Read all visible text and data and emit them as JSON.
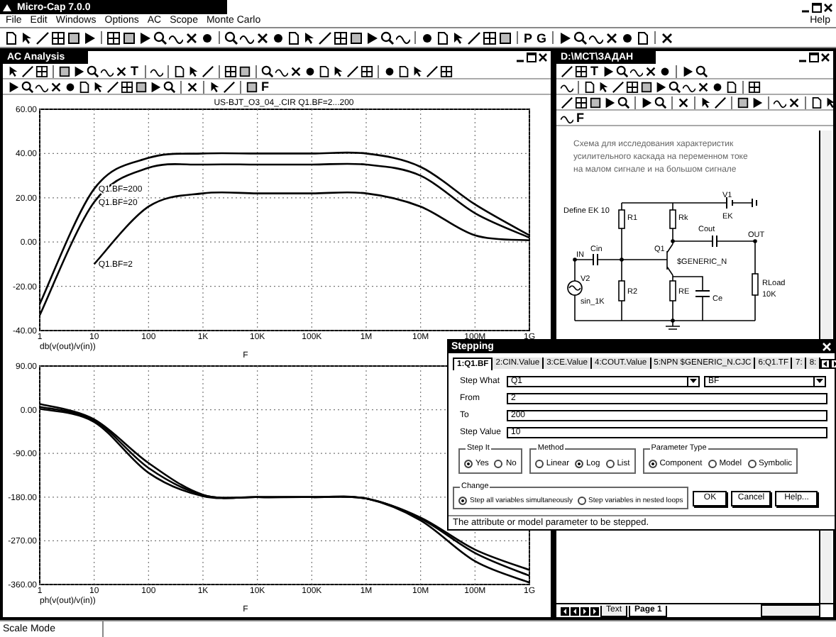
{
  "window": {
    "title": "Micro-Cap 7.0.0"
  },
  "menu": [
    "File",
    "Edit",
    "Windows",
    "Options",
    "AC",
    "Scope",
    "Monte Carlo"
  ],
  "help_menu": "Help",
  "toolbar": [
    [
      {
        "kind": "icon"
      },
      {
        "kind": "icon"
      },
      {
        "kind": "icon"
      },
      {
        "kind": "icon"
      },
      {
        "kind": "icon"
      },
      {
        "kind": "icon"
      }
    ],
    [
      {
        "kind": "icon"
      },
      {
        "kind": "icon"
      },
      {
        "kind": "icon"
      },
      {
        "kind": "icon"
      },
      {
        "kind": "icon"
      },
      {
        "kind": "icon"
      },
      {
        "kind": "icon"
      }
    ],
    [
      {
        "kind": "icon"
      },
      {
        "kind": "icon"
      },
      {
        "kind": "icon"
      },
      {
        "kind": "icon"
      },
      {
        "kind": "icon"
      },
      {
        "kind": "icon"
      },
      {
        "kind": "icon"
      },
      {
        "kind": "icon"
      },
      {
        "kind": "icon"
      },
      {
        "kind": "icon"
      },
      {
        "kind": "icon"
      },
      {
        "kind": "icon"
      }
    ],
    [
      {
        "kind": "icon"
      },
      {
        "kind": "icon"
      },
      {
        "kind": "icon"
      },
      {
        "kind": "icon"
      },
      {
        "kind": "icon"
      },
      {
        "kind": "icon"
      }
    ],
    [
      {
        "kind": "text",
        "label": "P"
      },
      {
        "kind": "text",
        "label": "G"
      }
    ],
    [
      {
        "kind": "icon"
      },
      {
        "kind": "icon"
      },
      {
        "kind": "icon"
      },
      {
        "kind": "icon"
      },
      {
        "kind": "icon"
      },
      {
        "kind": "icon"
      }
    ],
    [
      {
        "kind": "icon"
      }
    ]
  ],
  "ac_window": {
    "title": "AC Analysis",
    "toolbar_rows": [
      [
        [
          {
            "kind": "icon"
          },
          {
            "kind": "icon"
          },
          {
            "kind": "icon"
          }
        ],
        [
          {
            "kind": "icon"
          },
          {
            "kind": "icon"
          },
          {
            "kind": "icon"
          },
          {
            "kind": "icon"
          },
          {
            "kind": "icon"
          },
          {
            "kind": "text",
            "label": "T"
          }
        ],
        [
          {
            "kind": "icon"
          }
        ],
        [
          {
            "kind": "icon"
          },
          {
            "kind": "icon"
          },
          {
            "kind": "icon"
          }
        ],
        [
          {
            "kind": "icon"
          },
          {
            "kind": "icon"
          }
        ],
        [
          {
            "kind": "icon"
          },
          {
            "kind": "icon"
          },
          {
            "kind": "icon"
          },
          {
            "kind": "icon"
          },
          {
            "kind": "icon"
          },
          {
            "kind": "icon"
          },
          {
            "kind": "icon"
          },
          {
            "kind": "icon"
          }
        ],
        [
          {
            "kind": "icon"
          },
          {
            "kind": "icon"
          },
          {
            "kind": "icon"
          },
          {
            "kind": "icon"
          },
          {
            "kind": "icon"
          }
        ]
      ],
      [
        [
          {
            "kind": "icon"
          },
          {
            "kind": "icon"
          },
          {
            "kind": "icon"
          },
          {
            "kind": "icon"
          },
          {
            "kind": "icon"
          },
          {
            "kind": "icon"
          },
          {
            "kind": "icon"
          },
          {
            "kind": "icon"
          },
          {
            "kind": "icon"
          },
          {
            "kind": "icon"
          },
          {
            "kind": "icon"
          },
          {
            "kind": "icon"
          }
        ],
        [
          {
            "kind": "icon"
          }
        ],
        [
          {
            "kind": "icon"
          },
          {
            "kind": "icon"
          }
        ],
        [
          {
            "kind": "icon"
          },
          {
            "kind": "text",
            "label": "F"
          }
        ]
      ]
    ],
    "upper_plot": {
      "expression": "db(v(out)/v(in))",
      "chart_data": {
        "type": "line",
        "grid": true,
        "title": "US-BJT_O3_04_.CIR Q1.BF=2...200",
        "xlabel": "F",
        "categories": [
          "1",
          "10",
          "100",
          "1K",
          "10K",
          "100K",
          "1M",
          "10M",
          "100M",
          "1G"
        ],
        "series": [
          {
            "name": "Q1.BF=200",
            "color": "#000000",
            "values": [
              -28,
              24,
              38,
              40,
              40,
              40,
              40,
              34,
              17,
              3
            ]
          },
          {
            "name": "Q1.BF=20",
            "color": "#000000",
            "values": [
              -33,
              18,
              33.5,
              35,
              35,
              35,
              35,
              30,
              13,
              2
            ]
          },
          {
            "name": "Q1.BF=2",
            "color": "#000000",
            "values": [
              null,
              -10,
              16,
              22,
              22,
              22,
              22,
              16,
              3,
              0.8
            ]
          }
        ],
        "ylim": [
          -40,
          60
        ],
        "yticks": [
          {
            "value": 60,
            "label": "60.00"
          },
          {
            "value": 40,
            "label": "40.00"
          },
          {
            "value": 20,
            "label": "20.00"
          },
          {
            "value": 0,
            "label": "0.00"
          },
          {
            "value": -20,
            "label": "-20.00"
          },
          {
            "value": -40,
            "label": "-40.00"
          }
        ]
      }
    },
    "lower_plot": {
      "expression": "ph(v(out)/v(in))",
      "chart_data": {
        "type": "line",
        "grid": true,
        "xlabel": "F",
        "categories": [
          "1",
          "10",
          "100",
          "1K",
          "10K",
          "100K",
          "1M",
          "10M",
          "100M",
          "1G"
        ],
        "series": [
          {
            "color": "#000000",
            "values": [
              12,
              -20,
              -110,
              -175,
              -180,
              -180,
              -183,
              -222,
              -288,
              -330
            ]
          },
          {
            "color": "#000000",
            "values": [
              6,
              -22,
              -120,
              -176,
              -180,
              -180,
              -183,
              -224,
              -295,
              -342
            ]
          },
          {
            "color": "#000000",
            "values": [
              2,
              -25,
              -130,
              -178,
              -180,
              -180,
              -183,
              -228,
              -312,
              -356
            ]
          }
        ],
        "ylim": [
          -360,
          90
        ],
        "yticks": [
          {
            "value": 90,
            "label": "90.00"
          },
          {
            "value": 0,
            "label": "0.00"
          },
          {
            "value": -90,
            "label": "-90.00"
          },
          {
            "value": -180,
            "label": "-180.00"
          },
          {
            "value": -270,
            "label": "-270.00"
          },
          {
            "value": -360,
            "label": "-360.00"
          }
        ]
      }
    }
  },
  "schematic_window": {
    "title": "D:\\МСТ\\ЗАДАН",
    "toolbar_rows": [
      [
        [
          {
            "kind": "icon"
          },
          {
            "kind": "icon"
          },
          {
            "kind": "text",
            "label": "T"
          },
          {
            "kind": "icon"
          },
          {
            "kind": "icon"
          },
          {
            "kind": "icon"
          },
          {
            "kind": "icon"
          },
          {
            "kind": "icon"
          }
        ],
        [
          {
            "kind": "icon"
          },
          {
            "kind": "icon"
          }
        ]
      ],
      [
        [
          {
            "kind": "icon"
          }
        ],
        [
          {
            "kind": "icon"
          },
          {
            "kind": "icon"
          },
          {
            "kind": "icon"
          },
          {
            "kind": "icon"
          },
          {
            "kind": "icon"
          },
          {
            "kind": "icon"
          },
          {
            "kind": "icon"
          },
          {
            "kind": "icon"
          },
          {
            "kind": "icon"
          },
          {
            "kind": "icon"
          },
          {
            "kind": "icon"
          }
        ],
        [
          {
            "kind": "icon"
          }
        ]
      ],
      [
        [
          {
            "kind": "icon"
          },
          {
            "kind": "icon"
          },
          {
            "kind": "icon"
          },
          {
            "kind": "icon"
          },
          {
            "kind": "icon"
          }
        ],
        [
          {
            "kind": "icon"
          },
          {
            "kind": "icon"
          }
        ],
        [
          {
            "kind": "icon"
          }
        ],
        [
          {
            "kind": "icon"
          },
          {
            "kind": "icon"
          }
        ],
        [
          {
            "kind": "icon"
          },
          {
            "kind": "icon"
          }
        ],
        [
          {
            "kind": "icon"
          },
          {
            "kind": "icon"
          }
        ],
        [
          {
            "kind": "icon"
          },
          {
            "kind": "icon"
          }
        ]
      ],
      [
        [
          {
            "kind": "icon"
          },
          {
            "kind": "text",
            "label": "F"
          }
        ]
      ]
    ],
    "note": [
      "Схема для исследования характеристик",
      "усилительного каскада на переменном токе",
      "на малом сигнале и на большом сигнале"
    ],
    "labels": [
      "Define EK 10",
      "R1",
      "Rk",
      "V1",
      "EK",
      "Cout",
      "OUT",
      "IN",
      "Cin",
      "Q1",
      "$GENERIC_N",
      "V2",
      "sin_1K",
      "R2",
      "RE",
      "Ce",
      "RLoad",
      "10K"
    ],
    "page_tabs": [
      {
        "label": "Text",
        "selected": false
      },
      {
        "label": "Page 1",
        "selected": true
      }
    ]
  },
  "stepping": {
    "title": "Stepping",
    "tabs": [
      {
        "label": "1:Q1.BF",
        "selected": true
      },
      {
        "label": "2:CIN.Value",
        "selected": false
      },
      {
        "label": "3:CE.Value",
        "selected": false
      },
      {
        "label": "4:COUT.Value",
        "selected": false
      },
      {
        "label": "5:NPN $GENERIC_N.CJC",
        "selected": false
      },
      {
        "label": "6:Q1.TF",
        "selected": false
      },
      {
        "label": "7:",
        "selected": false
      },
      {
        "label": "8:",
        "selected": false
      }
    ],
    "step_what": {
      "label": "Step What",
      "object": "Q1",
      "parameter": "BF"
    },
    "fields": [
      {
        "label": "From",
        "value": "2"
      },
      {
        "label": "To",
        "value": "200"
      },
      {
        "label": "Step Value",
        "value": "10"
      }
    ],
    "groups": [
      {
        "title": "Step It",
        "options": [
          {
            "label": "Yes",
            "selected": true
          },
          {
            "label": "No",
            "selected": false
          }
        ]
      },
      {
        "title": "Method",
        "options": [
          {
            "label": "Linear",
            "selected": false
          },
          {
            "label": "Log",
            "selected": true
          },
          {
            "label": "List",
            "selected": false
          }
        ]
      },
      {
        "title": "Parameter Type",
        "options": [
          {
            "label": "Component",
            "selected": true
          },
          {
            "label": "Model",
            "selected": false
          },
          {
            "label": "Symbolic",
            "selected": false
          }
        ]
      }
    ],
    "change": {
      "title": "Change",
      "options": [
        {
          "label": "Step all variables simultaneously",
          "selected": true
        },
        {
          "label": "Step variables in nested loops",
          "selected": false
        }
      ]
    },
    "buttons": [
      "OK",
      "Cancel",
      "Help..."
    ],
    "hint": "The attribute or model parameter to be stepped."
  },
  "status_bar": {
    "mode": "Scale Mode"
  }
}
